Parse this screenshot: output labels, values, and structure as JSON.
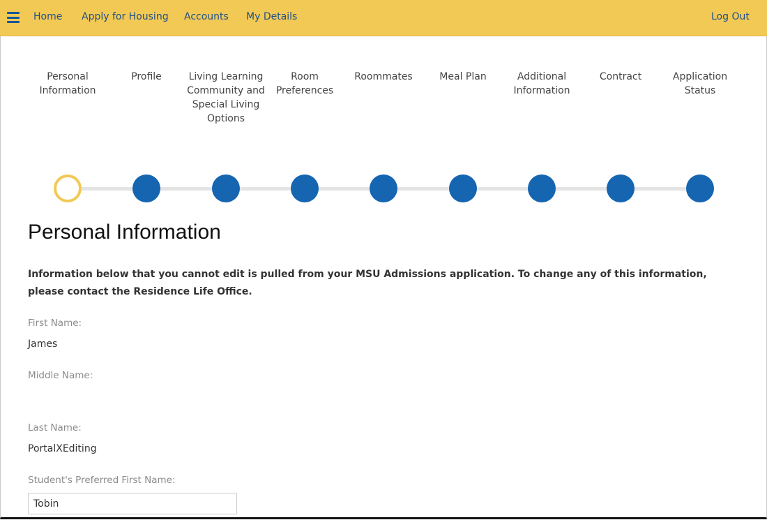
{
  "nav": {
    "menu_icon": "hamburger-menu-icon",
    "links": [
      "Home",
      "Apply for Housing",
      "Accounts",
      "My Details"
    ],
    "logout": "Log Out"
  },
  "steps": [
    {
      "label": "Personal Information",
      "state": "current"
    },
    {
      "label": "Profile",
      "state": "pending"
    },
    {
      "label": "Living Learning Community and Special Living Options",
      "state": "pending"
    },
    {
      "label": "Room Preferences",
      "state": "pending"
    },
    {
      "label": "Roommates",
      "state": "pending"
    },
    {
      "label": "Meal Plan",
      "state": "pending"
    },
    {
      "label": "Additional Information",
      "state": "pending"
    },
    {
      "label": "Contract",
      "state": "pending"
    },
    {
      "label": "Application Status",
      "state": "pending"
    }
  ],
  "main": {
    "title": "Personal Information",
    "info": "Information below that you cannot edit is pulled from your MSU Admissions application. To change any of this information, please contact the Residence Life Office.",
    "fields": {
      "first_name": {
        "label": "First Name:",
        "value": "James"
      },
      "middle_name": {
        "label": "Middle Name:",
        "value": ""
      },
      "last_name": {
        "label": "Last Name:",
        "value": "PortalXEditing"
      },
      "preferred_name": {
        "label": "Student's Preferred First Name:",
        "value": "Tobin"
      }
    }
  },
  "colors": {
    "header_bg": "#f2c955",
    "link": "#1f4f86",
    "step_dot": "#1565b1",
    "current_ring": "#f2c955"
  }
}
